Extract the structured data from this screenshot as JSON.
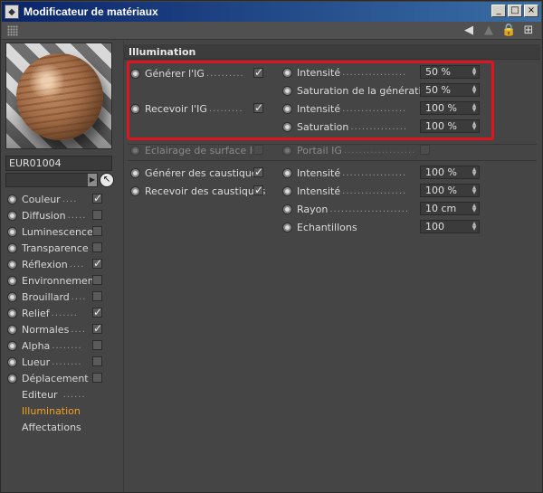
{
  "window": {
    "title": "Modificateur de matériaux",
    "controls": {
      "minimize": "_",
      "maximize": "□",
      "close": "×"
    }
  },
  "toolbar": {
    "icons": [
      "grip-icon",
      "arrow-back-icon",
      "arrow-forward-icon",
      "lock-icon",
      "new-window-icon"
    ]
  },
  "material": {
    "name": "EUR01004",
    "preview": "wood-sphere"
  },
  "channels": [
    {
      "label": "Couleur",
      "checked": true
    },
    {
      "label": "Diffusion",
      "checked": false
    },
    {
      "label": "Luminescence",
      "checked": false
    },
    {
      "label": "Transparence",
      "checked": false
    },
    {
      "label": "Réflexion",
      "checked": true
    },
    {
      "label": "Environnement",
      "checked": false
    },
    {
      "label": "Brouillard",
      "checked": false
    },
    {
      "label": "Relief",
      "checked": true
    },
    {
      "label": "Normales",
      "checked": true
    },
    {
      "label": "Alpha",
      "checked": false
    },
    {
      "label": "Lueur",
      "checked": false
    },
    {
      "label": "Déplacement",
      "checked": false
    }
  ],
  "pages": [
    {
      "label": "Editeur",
      "active": false
    },
    {
      "label": "Illumination",
      "active": true
    },
    {
      "label": "Affectations",
      "active": false
    }
  ],
  "illumination": {
    "title": "Illumination",
    "generate_gi": {
      "label": "Générer l'IG",
      "checked": true
    },
    "receive_gi": {
      "label": "Recevoir l'IG",
      "checked": true
    },
    "gi_intensity_gen": {
      "label": "Intensité",
      "value": "50 %"
    },
    "gi_saturation_gen": {
      "label": "Saturation de la génération",
      "value": "50 %"
    },
    "gi_intensity_rec": {
      "label": "Intensité",
      "value": "100 %"
    },
    "gi_saturation_rec": {
      "label": "Saturation",
      "value": "100 %"
    },
    "area_light": {
      "label": "Eclairage de surface IG",
      "checked": false
    },
    "gi_portal": {
      "label": "Portail IG",
      "checked": false
    },
    "gen_caustics": {
      "label": "Générer des caustiques",
      "checked": true
    },
    "rec_caustics": {
      "label": "Recevoir des caustiques",
      "checked": true
    },
    "caustic_intensity_gen": {
      "label": "Intensité",
      "value": "100 %"
    },
    "caustic_intensity_rec": {
      "label": "Intensité",
      "value": "100 %"
    },
    "caustic_radius": {
      "label": "Rayon",
      "value": "10 cm"
    },
    "caustic_samples": {
      "label": "Echantillons",
      "value": "100"
    }
  },
  "colors": {
    "highlight": "#e0141e",
    "active_page": "#f0a020",
    "titlebar_start": "#0a246a",
    "titlebar_end": "#3a6ea5"
  }
}
